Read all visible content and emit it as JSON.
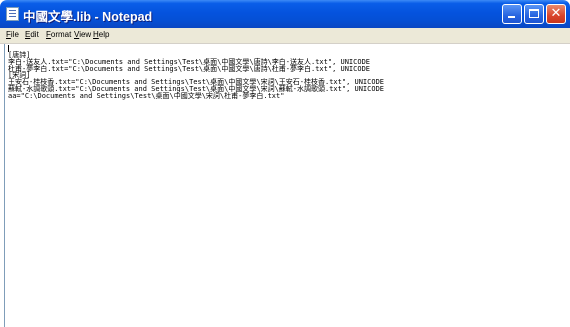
{
  "window": {
    "title": "中國文學.lib - Notepad",
    "controls": {
      "minimize": "minimize-icon",
      "maximize": "maximize-icon",
      "close": "close-icon"
    },
    "colors": {
      "titlebar": "#0553de",
      "close_button": "#d9442b",
      "menubar": "#ece9d8"
    }
  },
  "menu": {
    "items": [
      {
        "label": "File"
      },
      {
        "label": "Edit"
      },
      {
        "label": "Format"
      },
      {
        "label": "View"
      },
      {
        "label": "Help"
      }
    ]
  },
  "editor": {
    "lines": [
      "",
      "[唐詩]",
      "李白-送友人.txt=\"C:\\Documents and Settings\\Test\\桌面\\中國文學\\唐詩\\李白-送友人.txt\", UNICODE",
      "杜甫-夢李白.txt=\"C:\\Documents and Settings\\Test\\桌面\\中國文學\\唐詩\\杜甫-夢李白.txt\", UNICODE",
      "[宋詞]",
      "王安石-桂枝香.txt=\"C:\\Documents and Settings\\Test\\桌面\\中國文學\\宋詞\\王安石-桂枝香.txt\", UNICODE",
      "蘇軾-水調歌頭.txt=\"C:\\Documents and Settings\\Test\\桌面\\中國文學\\宋詞\\蘇軾-水調歌頭.txt\", UNICODE",
      "aa=\"C:\\Documents and Settings\\Test\\桌面\\中國文學\\宋詞\\杜甫-夢李白.txt\""
    ]
  }
}
